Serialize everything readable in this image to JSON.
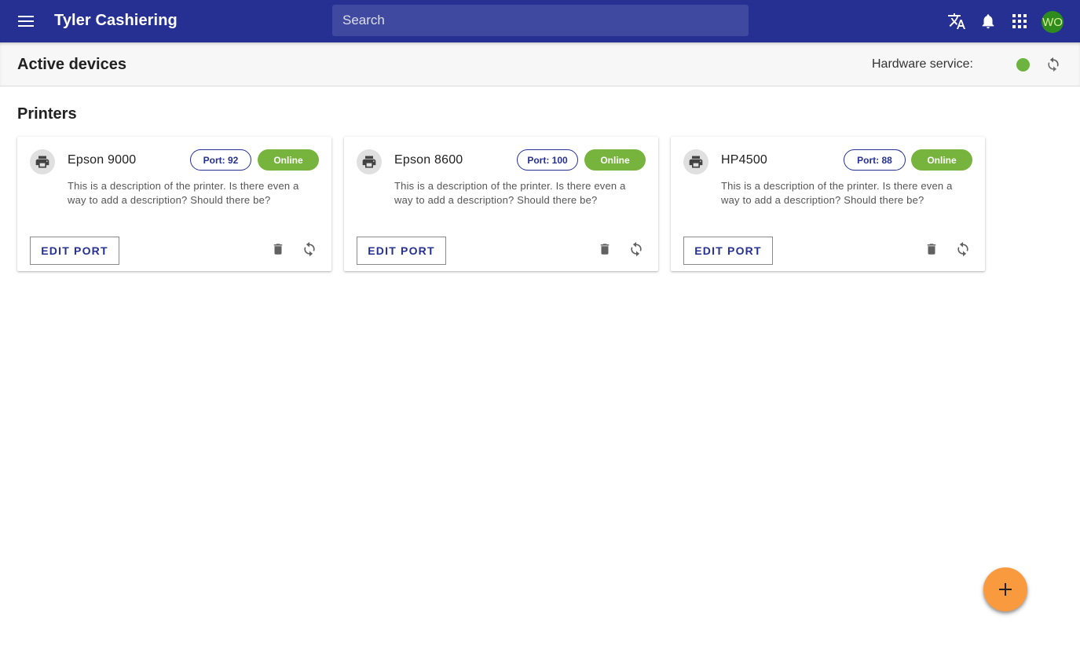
{
  "app": {
    "title": "Tyler Cashiering",
    "search_placeholder": "Search",
    "avatar_initials": "WO",
    "brand_color": "#253092"
  },
  "header": {
    "title": "Active devices",
    "hardware_label": "Hardware service:",
    "hardware_status_color": "#6db33f"
  },
  "section": {
    "title": "Printers"
  },
  "printers": [
    {
      "name": "Epson 9000",
      "port": "Port: 92",
      "status": "Online",
      "description": "This is a description of the printer. Is there even a way to add a description? Should there be?",
      "edit_label": "EDIT PORT"
    },
    {
      "name": "Epson 8600",
      "port": "Port: 100",
      "status": "Online",
      "description": "This is a description of the printer. Is there even a way to add a description? Should there be?",
      "edit_label": "EDIT PORT"
    },
    {
      "name": "HP4500",
      "port": "Port: 88",
      "status": "Online",
      "description": "This is a description of the printer. Is there even a way to add a description? Should there be?",
      "edit_label": "EDIT PORT"
    }
  ],
  "icons": {
    "menu": "menu-icon",
    "translate": "translate-icon",
    "notifications": "bell-icon",
    "apps": "apps-grid-icon",
    "printer": "printer-icon",
    "delete": "trash-icon",
    "refresh": "refresh-icon",
    "add": "plus-icon"
  },
  "fab_color": "#f99a3e",
  "status_online_color": "#76b43d"
}
